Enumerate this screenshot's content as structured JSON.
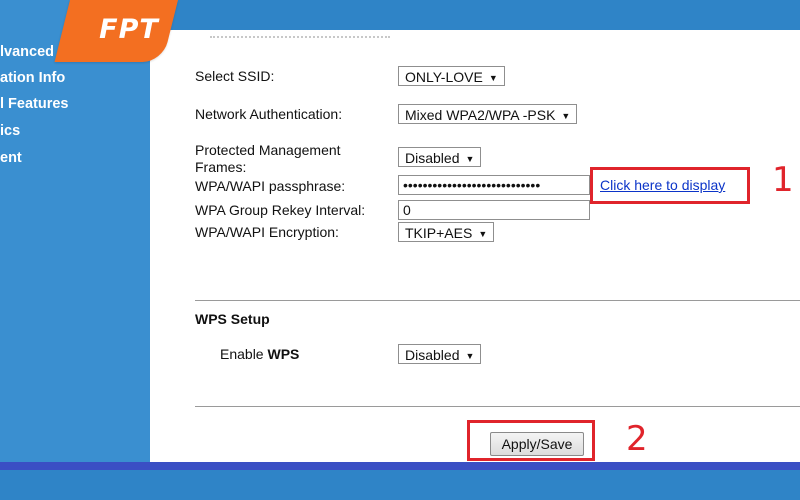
{
  "sidebar": {
    "items": [
      {
        "label": "lvanced",
        "top": 0
      },
      {
        "label": "ation Info",
        "top": 0
      },
      {
        "label": "l Features",
        "top": 0
      },
      {
        "label": "ics",
        "top": 0
      },
      {
        "label": "ent",
        "top": 0
      }
    ]
  },
  "logo": {
    "text": "FPT",
    "color": "#f36f21"
  },
  "form": {
    "ssid": {
      "label": "Select SSID:",
      "value": "ONLY-LOVE"
    },
    "auth": {
      "label": "Network Authentication:",
      "value": "Mixed WPA2/WPA -PSK"
    },
    "pmf": {
      "label_line1": "Protected Management",
      "label_line2": "Frames:",
      "value": "Disabled"
    },
    "passphrase": {
      "label": "WPA/WAPI passphrase:",
      "value": "••••••••••••••••••••••••••••",
      "link": "Click here to display"
    },
    "rekey": {
      "label": "WPA Group Rekey Interval:",
      "value": "0"
    },
    "encryption": {
      "label": "WPA/WAPI Encryption:",
      "value": "TKIP+AES"
    }
  },
  "wps": {
    "title": "WPS Setup",
    "enable_label_prefix": "Enable ",
    "enable_label_bold": "WPS",
    "value": "Disabled"
  },
  "actions": {
    "apply_save": "Apply/Save"
  },
  "annotations": {
    "one": "1",
    "two": "2",
    "highlight_color": "#e0242b"
  }
}
